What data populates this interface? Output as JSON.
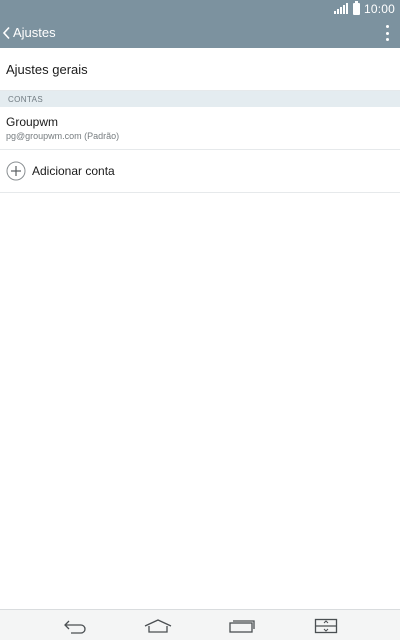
{
  "status_bar": {
    "time": "10:00"
  },
  "app_bar": {
    "title": "Ajustes"
  },
  "items": {
    "general_settings": "Ajustes gerais",
    "accounts_header": "CONTAS",
    "account": {
      "name": "Groupwm",
      "email": "pg@groupwm.com (Padrão)"
    },
    "add_account": "Adicionar conta"
  },
  "colors": {
    "app_bar": "#7c929f",
    "section_header_bg": "#e4ecf0"
  },
  "icons": {
    "back": "chevron-left-icon",
    "overflow": "vertical-ellipsis-icon",
    "add": "plus-circle-icon",
    "nav_back": "back-arrow-icon",
    "nav_home": "home-icon",
    "nav_recents": "recent-apps-icon",
    "nav_dual": "dual-window-icon"
  }
}
